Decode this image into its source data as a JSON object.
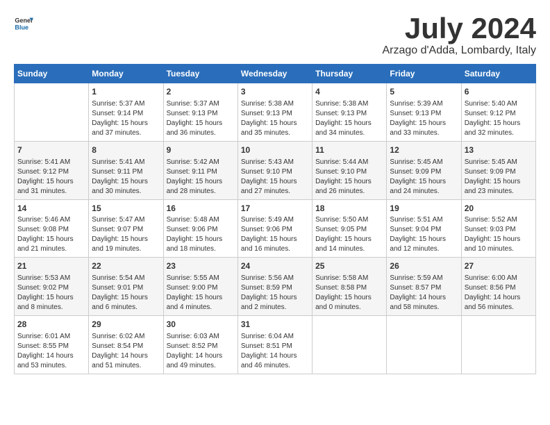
{
  "header": {
    "logo_line1": "General",
    "logo_line2": "Blue",
    "month_year": "July 2024",
    "location": "Arzago d'Adda, Lombardy, Italy"
  },
  "weekdays": [
    "Sunday",
    "Monday",
    "Tuesday",
    "Wednesday",
    "Thursday",
    "Friday",
    "Saturday"
  ],
  "weeks": [
    [
      {
        "day": "",
        "info": ""
      },
      {
        "day": "1",
        "info": "Sunrise: 5:37 AM\nSunset: 9:14 PM\nDaylight: 15 hours\nand 37 minutes."
      },
      {
        "day": "2",
        "info": "Sunrise: 5:37 AM\nSunset: 9:13 PM\nDaylight: 15 hours\nand 36 minutes."
      },
      {
        "day": "3",
        "info": "Sunrise: 5:38 AM\nSunset: 9:13 PM\nDaylight: 15 hours\nand 35 minutes."
      },
      {
        "day": "4",
        "info": "Sunrise: 5:38 AM\nSunset: 9:13 PM\nDaylight: 15 hours\nand 34 minutes."
      },
      {
        "day": "5",
        "info": "Sunrise: 5:39 AM\nSunset: 9:13 PM\nDaylight: 15 hours\nand 33 minutes."
      },
      {
        "day": "6",
        "info": "Sunrise: 5:40 AM\nSunset: 9:12 PM\nDaylight: 15 hours\nand 32 minutes."
      }
    ],
    [
      {
        "day": "7",
        "info": "Sunrise: 5:41 AM\nSunset: 9:12 PM\nDaylight: 15 hours\nand 31 minutes."
      },
      {
        "day": "8",
        "info": "Sunrise: 5:41 AM\nSunset: 9:11 PM\nDaylight: 15 hours\nand 30 minutes."
      },
      {
        "day": "9",
        "info": "Sunrise: 5:42 AM\nSunset: 9:11 PM\nDaylight: 15 hours\nand 28 minutes."
      },
      {
        "day": "10",
        "info": "Sunrise: 5:43 AM\nSunset: 9:10 PM\nDaylight: 15 hours\nand 27 minutes."
      },
      {
        "day": "11",
        "info": "Sunrise: 5:44 AM\nSunset: 9:10 PM\nDaylight: 15 hours\nand 26 minutes."
      },
      {
        "day": "12",
        "info": "Sunrise: 5:45 AM\nSunset: 9:09 PM\nDaylight: 15 hours\nand 24 minutes."
      },
      {
        "day": "13",
        "info": "Sunrise: 5:45 AM\nSunset: 9:09 PM\nDaylight: 15 hours\nand 23 minutes."
      }
    ],
    [
      {
        "day": "14",
        "info": "Sunrise: 5:46 AM\nSunset: 9:08 PM\nDaylight: 15 hours\nand 21 minutes."
      },
      {
        "day": "15",
        "info": "Sunrise: 5:47 AM\nSunset: 9:07 PM\nDaylight: 15 hours\nand 19 minutes."
      },
      {
        "day": "16",
        "info": "Sunrise: 5:48 AM\nSunset: 9:06 PM\nDaylight: 15 hours\nand 18 minutes."
      },
      {
        "day": "17",
        "info": "Sunrise: 5:49 AM\nSunset: 9:06 PM\nDaylight: 15 hours\nand 16 minutes."
      },
      {
        "day": "18",
        "info": "Sunrise: 5:50 AM\nSunset: 9:05 PM\nDaylight: 15 hours\nand 14 minutes."
      },
      {
        "day": "19",
        "info": "Sunrise: 5:51 AM\nSunset: 9:04 PM\nDaylight: 15 hours\nand 12 minutes."
      },
      {
        "day": "20",
        "info": "Sunrise: 5:52 AM\nSunset: 9:03 PM\nDaylight: 15 hours\nand 10 minutes."
      }
    ],
    [
      {
        "day": "21",
        "info": "Sunrise: 5:53 AM\nSunset: 9:02 PM\nDaylight: 15 hours\nand 8 minutes."
      },
      {
        "day": "22",
        "info": "Sunrise: 5:54 AM\nSunset: 9:01 PM\nDaylight: 15 hours\nand 6 minutes."
      },
      {
        "day": "23",
        "info": "Sunrise: 5:55 AM\nSunset: 9:00 PM\nDaylight: 15 hours\nand 4 minutes."
      },
      {
        "day": "24",
        "info": "Sunrise: 5:56 AM\nSunset: 8:59 PM\nDaylight: 15 hours\nand 2 minutes."
      },
      {
        "day": "25",
        "info": "Sunrise: 5:58 AM\nSunset: 8:58 PM\nDaylight: 15 hours\nand 0 minutes."
      },
      {
        "day": "26",
        "info": "Sunrise: 5:59 AM\nSunset: 8:57 PM\nDaylight: 14 hours\nand 58 minutes."
      },
      {
        "day": "27",
        "info": "Sunrise: 6:00 AM\nSunset: 8:56 PM\nDaylight: 14 hours\nand 56 minutes."
      }
    ],
    [
      {
        "day": "28",
        "info": "Sunrise: 6:01 AM\nSunset: 8:55 PM\nDaylight: 14 hours\nand 53 minutes."
      },
      {
        "day": "29",
        "info": "Sunrise: 6:02 AM\nSunset: 8:54 PM\nDaylight: 14 hours\nand 51 minutes."
      },
      {
        "day": "30",
        "info": "Sunrise: 6:03 AM\nSunset: 8:52 PM\nDaylight: 14 hours\nand 49 minutes."
      },
      {
        "day": "31",
        "info": "Sunrise: 6:04 AM\nSunset: 8:51 PM\nDaylight: 14 hours\nand 46 minutes."
      },
      {
        "day": "",
        "info": ""
      },
      {
        "day": "",
        "info": ""
      },
      {
        "day": "",
        "info": ""
      }
    ]
  ]
}
